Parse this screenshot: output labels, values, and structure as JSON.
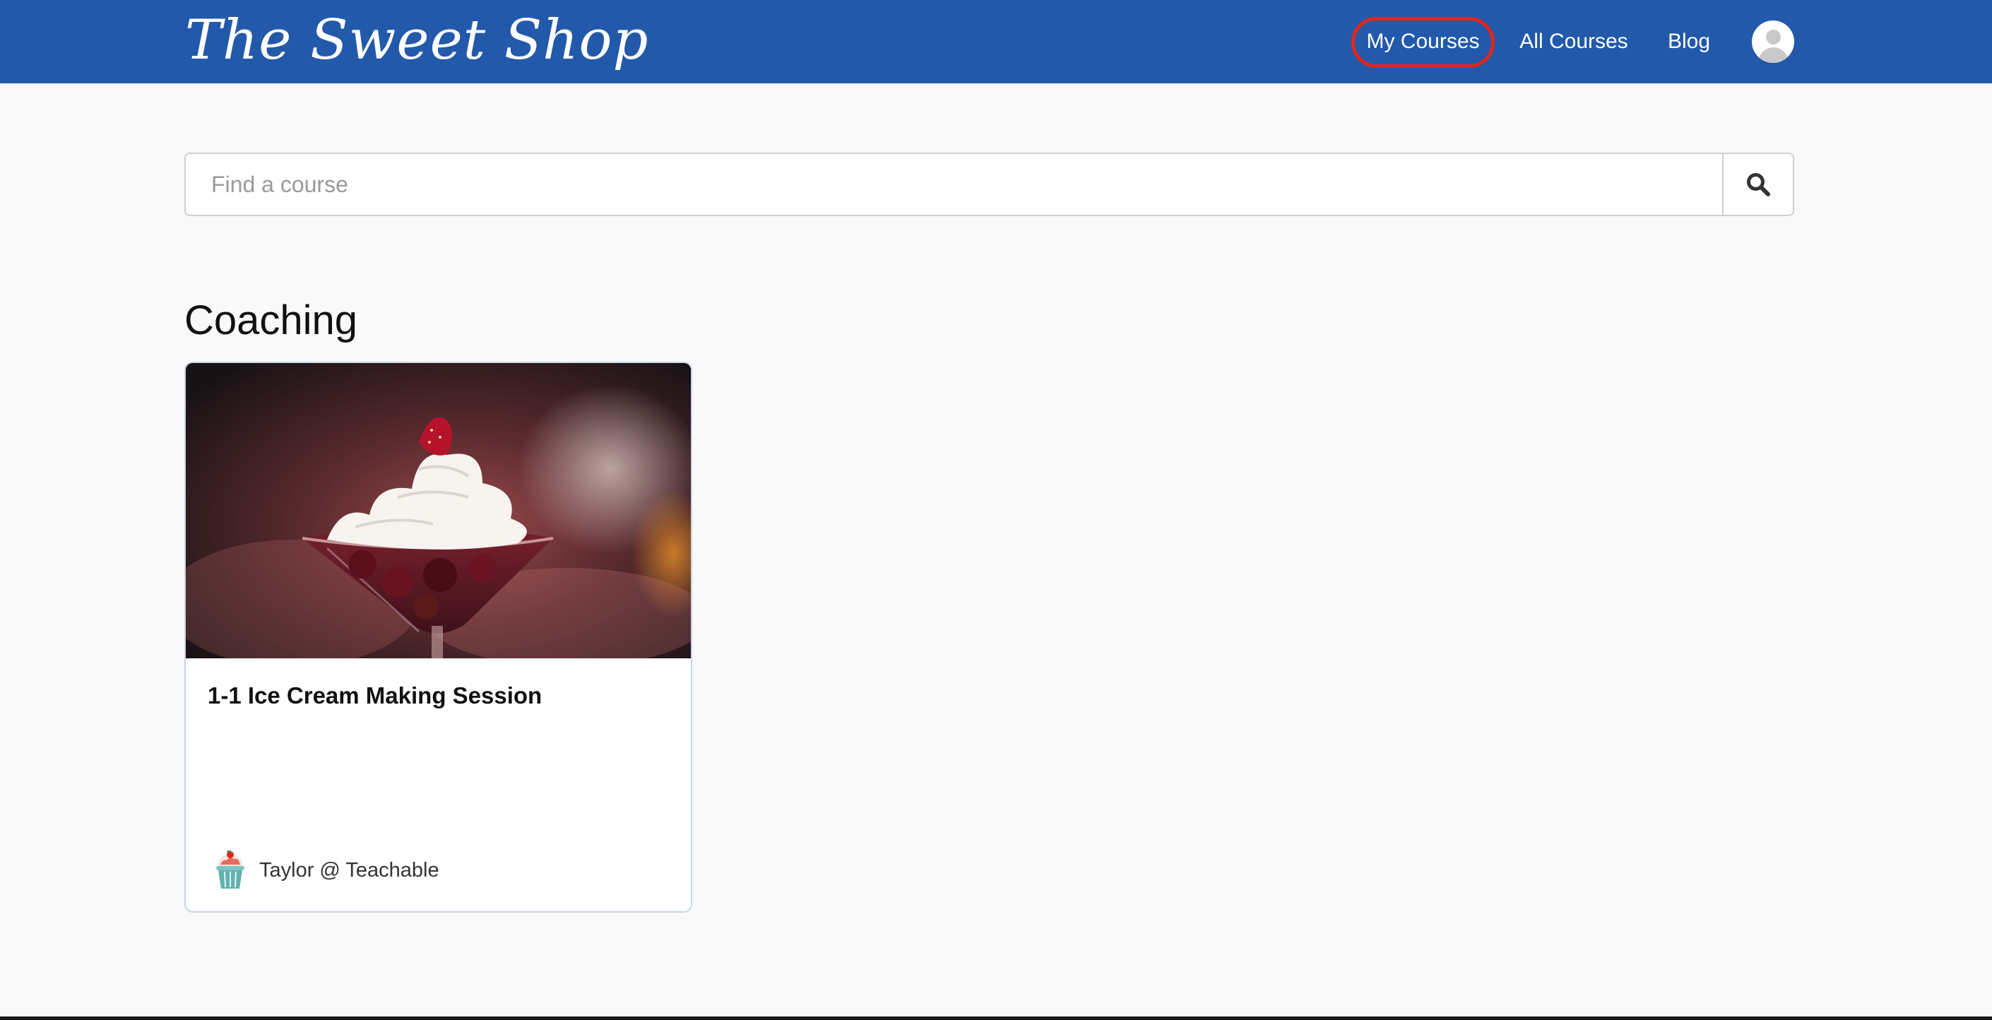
{
  "header": {
    "logo_text": "The Sweet Shop",
    "brand_color": "#2259aa",
    "nav": {
      "my_courses": "My Courses",
      "all_courses": "All Courses",
      "blog": "Blog"
    },
    "highlight_color": "#e0261b",
    "avatar_icon": "user-avatar-icon"
  },
  "search": {
    "placeholder": "Find a course",
    "value": "",
    "button_icon": "search-icon"
  },
  "sections": [
    {
      "title": "Coaching",
      "courses": [
        {
          "title": "1-1 Ice Cream Making Session",
          "image": "ice-cream-sundae-image",
          "author": "Taylor @ Teachable",
          "author_icon": "cupcake-icon"
        }
      ]
    }
  ]
}
